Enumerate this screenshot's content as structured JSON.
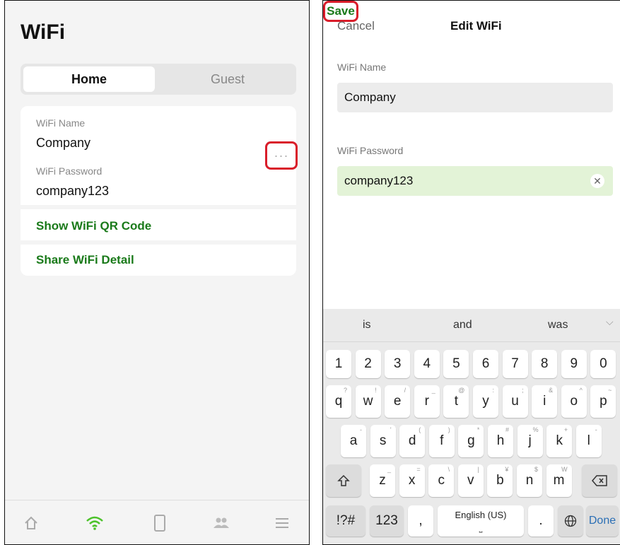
{
  "left": {
    "title": "WiFi",
    "tabs": [
      {
        "label": "Home",
        "active": true
      },
      {
        "label": "Guest",
        "active": false
      }
    ],
    "card": {
      "wifi_name_label": "WiFi Name",
      "wifi_name_value": "Company",
      "wifi_password_label": "WiFi Password",
      "wifi_password_value": "company123",
      "more_label": "···",
      "show_qr_label": "Show WiFi QR Code",
      "share_label": "Share WiFi Detail"
    },
    "nav": [
      "home-icon",
      "wifi-icon",
      "device-icon",
      "users-icon",
      "menu-icon"
    ],
    "active_nav": "wifi-icon"
  },
  "right": {
    "cancel_label": "Cancel",
    "title": "Edit WiFi",
    "save_label": "Save",
    "wifi_name_label": "WiFi Name",
    "wifi_name_value": "Company",
    "wifi_password_label": "WiFi Password",
    "wifi_password_value": "company123",
    "keyboard": {
      "suggestions": [
        "is",
        "and",
        "was"
      ],
      "row_numbers": [
        "1",
        "2",
        "3",
        "4",
        "5",
        "6",
        "7",
        "8",
        "9",
        "0"
      ],
      "row1": [
        {
          "k": "q",
          "h": "?"
        },
        {
          "k": "w",
          "h": "!"
        },
        {
          "k": "e",
          "h": "/"
        },
        {
          "k": "r",
          "h": "_"
        },
        {
          "k": "t",
          "h": "@"
        },
        {
          "k": "y",
          "h": ":"
        },
        {
          "k": "u",
          "h": ";"
        },
        {
          "k": "i",
          "h": "&"
        },
        {
          "k": "o",
          "h": "^"
        },
        {
          "k": "p",
          "h": "~"
        }
      ],
      "row2": [
        {
          "k": "a",
          "h": "-"
        },
        {
          "k": "s",
          "h": "'"
        },
        {
          "k": "d",
          "h": "("
        },
        {
          "k": "f",
          "h": ")"
        },
        {
          "k": "g",
          "h": "*"
        },
        {
          "k": "h",
          "h": "#"
        },
        {
          "k": "j",
          "h": "%"
        },
        {
          "k": "k",
          "h": "+"
        },
        {
          "k": "l",
          "h": "-"
        }
      ],
      "row3": [
        {
          "k": "z",
          "h": "_"
        },
        {
          "k": "x",
          "h": "="
        },
        {
          "k": "c",
          "h": "\\"
        },
        {
          "k": "v",
          "h": "|"
        },
        {
          "k": "b",
          "h": "¥"
        },
        {
          "k": "n",
          "h": "$"
        },
        {
          "k": "m",
          "h": "W"
        }
      ],
      "sym_label": "!?#",
      "num_label": "123",
      "comma_label": ",",
      "space_label": "English (US)",
      "period_label": ".",
      "done_label": "Done"
    }
  }
}
